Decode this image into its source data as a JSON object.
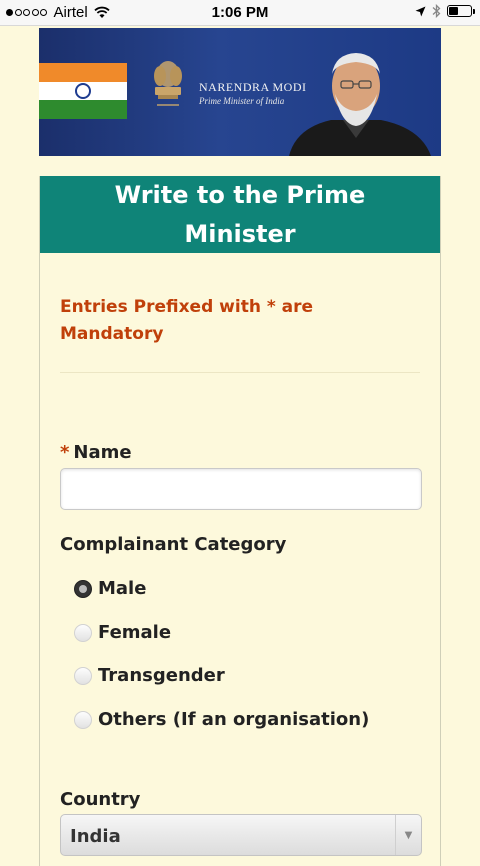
{
  "status_bar": {
    "carrier": "Airtel",
    "time": "1:06 PM",
    "signal_bars_filled": 1,
    "signal_bars_total": 5,
    "battery_level": 0.45
  },
  "banner": {
    "name": "NARENDRA MODI",
    "subtitle": "Prime Minister of India",
    "flag_colors": [
      "#f08a2a",
      "#ffffff",
      "#2e8b2e"
    ],
    "background_color": "#1f3a80"
  },
  "form": {
    "header_title": "Write to the Prime Minister",
    "header_color": "#0f8478",
    "mandatory_note": "Entries Prefixed with * are Mandatory",
    "required_marker": "*",
    "name_label": "Name",
    "name_value": "",
    "category_label": "Complainant Category",
    "categories": [
      {
        "label": "Male",
        "checked": true
      },
      {
        "label": "Female",
        "checked": false
      },
      {
        "label": "Transgender",
        "checked": false
      },
      {
        "label": "Others (If an organisation)",
        "checked": false
      }
    ],
    "country_label": "Country",
    "country_value": "India",
    "accent_color": "#c0400a"
  }
}
